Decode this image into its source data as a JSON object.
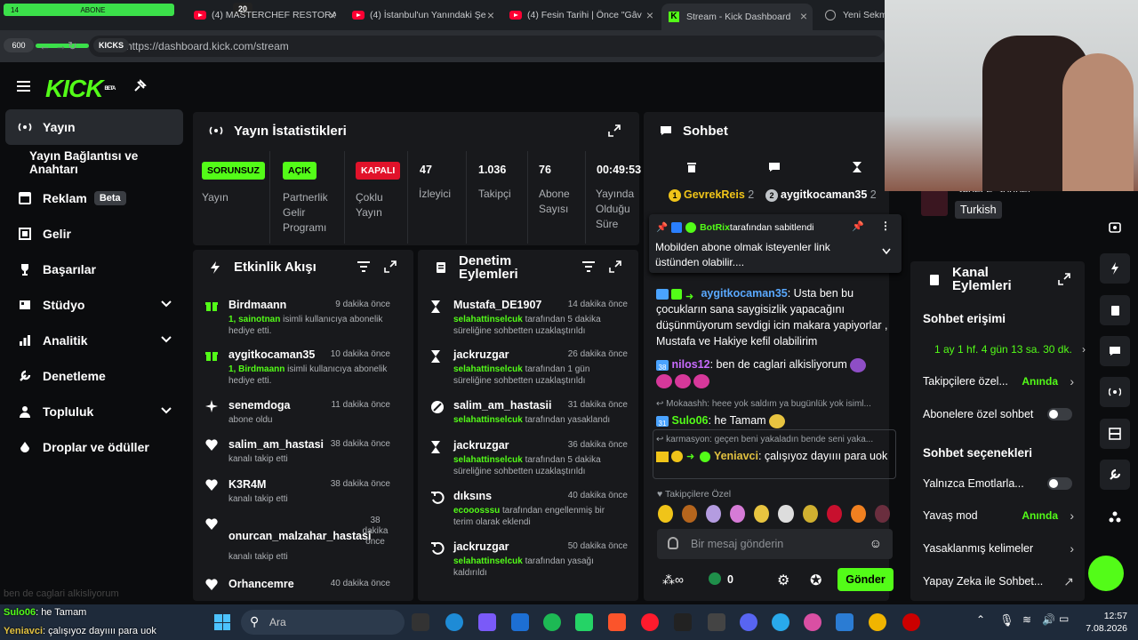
{
  "browser": {
    "green_bar_left": "14",
    "green_bar_mid": "ABONE",
    "badge_count": "20",
    "tabs": [
      {
        "title": "(4) MASTERCHEF RESTORA"
      },
      {
        "title": "(4) İstanbul'un Yanındaki Şe"
      },
      {
        "title": "(4) Fesin Tarihi | Önce \"Gâv"
      },
      {
        "title": "Stream - Kick Dashboard"
      },
      {
        "title": "Yeni Sekme"
      }
    ],
    "nav_pill": "600",
    "site_pill": "KICKS",
    "url": "https://dashboard.kick.com/stream"
  },
  "header": {
    "logo": "KICK",
    "logo_beta": "BETA"
  },
  "sidebar": {
    "items": [
      {
        "label": "Yayın"
      },
      {
        "label": "Yayın Bağlantısı ve Anahtarı"
      },
      {
        "label": "Reklam",
        "badge": "Beta"
      },
      {
        "label": "Gelir"
      },
      {
        "label": "Başarılar"
      },
      {
        "label": "Stüdyo"
      },
      {
        "label": "Analitik"
      },
      {
        "label": "Denetleme"
      },
      {
        "label": "Topluluk"
      },
      {
        "label": "Droplar ve ödüller"
      }
    ]
  },
  "stats": {
    "title": "Yayın İstatistikleri",
    "items": [
      {
        "pill": "SORUNSUZ",
        "label": "Yayın"
      },
      {
        "pill": "AÇIK",
        "label": "Partnerlik Gelir Programı"
      },
      {
        "pill": "KAPALI",
        "label": "Çoklu Yayın"
      },
      {
        "value": "47",
        "label": "İzleyici"
      },
      {
        "value": "1.036",
        "label": "Takipçi"
      },
      {
        "value": "76",
        "label": "Abone Sayısı"
      },
      {
        "value": "00:49:53",
        "label": "Yayında Olduğu Süre"
      }
    ]
  },
  "activity": {
    "title": "Etkinlik Akışı",
    "items": [
      {
        "name": "Birdmaann",
        "time": "9 dakika önce",
        "highlight": "1, sainotnan",
        "text": " isimli kullanıcıya abonelik hediye etti.",
        "icon": "gift-icon"
      },
      {
        "name": "aygitkocaman35",
        "time": "10 dakika önce",
        "highlight": "1, Birdmaann",
        "text": " isimli kullanıcıya abonelik hediye etti.",
        "icon": "gift-icon"
      },
      {
        "name": "senemdoga",
        "time": "11 dakika önce",
        "highlight": "",
        "text": "abone oldu",
        "icon": "sparkle-icon"
      },
      {
        "name": "salim_am_hastasi",
        "time": "38 dakika önce",
        "highlight": "",
        "text": "kanalı takip etti",
        "icon": "heart-icon"
      },
      {
        "name": "K3R4M",
        "time": "38 dakika önce",
        "highlight": "",
        "text": "kanalı takip etti",
        "icon": "heart-icon"
      },
      {
        "name": "onurcan_malzahar_hastasi",
        "time": "38 dakika önce",
        "highlight": "",
        "text": "kanalı takip etti",
        "icon": "heart-icon"
      },
      {
        "name": "Orhancemre",
        "time": "40 dakika önce",
        "highlight": "",
        "text": "",
        "icon": "heart-icon"
      }
    ]
  },
  "moderation": {
    "title": "Denetim Eylemleri",
    "items": [
      {
        "name": "Mustafa_DE1907",
        "time": "14 dakika önce",
        "highlight": "selahattinselcuk",
        "text": " tarafından 5 dakika süreliğine sohbetten uzaklaştırıldı"
      },
      {
        "name": "jackruzgar",
        "time": "26 dakika önce",
        "highlight": "selahattinselcuk",
        "text": " tarafından 1 gün süreliğine sohbetten uzaklaştırıldı"
      },
      {
        "name": "salim_am_hastasii",
        "time": "31 dakika önce",
        "highlight": "selahattinselcuk",
        "text": " tarafından yasaklandı"
      },
      {
        "name": "jackruzgar",
        "time": "36 dakika önce",
        "highlight": "selahattinselcuk",
        "text": " tarafından 5 dakika süreliğine sohbetten uzaklaştırıldı"
      },
      {
        "name": "dıksıns",
        "time": "40 dakika önce",
        "highlight": "ecooosssu",
        "text": " tarafından engellenmiş bir terim olarak eklendi"
      },
      {
        "name": "jackruzgar",
        "time": "50 dakika önce",
        "highlight": "selahattinselcuk",
        "text": " tarafından yasağı kaldırıldı"
      }
    ]
  },
  "chat": {
    "title": "Sohbet",
    "top_users": [
      {
        "name": "GevrekReis",
        "count": "2"
      },
      {
        "name": "aygitkocaman35",
        "count": "2"
      }
    ],
    "pinned_by": "BotRix",
    "pinned_suffix": " tarafından sabitlendi",
    "pinned_message": "Mobilden abone olmak isteyenler link üstünden olabilir....",
    "messages": [
      {
        "user": "aygitkocaman35",
        "color": "#5aa9ff",
        "text": ": Usta ben bu çocukların sana saygisizlik yapacağını düşünmüyorum sevdigi icin makara yapiyorlar , Mustafa ve Hakiye kefil olabilirim"
      },
      {
        "user": "nilos12",
        "color": "#c86bff",
        "text": ": ben de caglari alkisliyorum"
      },
      {
        "user": "Sulo06",
        "color": "#53fc18",
        "text": ": he Tamam",
        "reply": "Mokaashh: heee yok saldım ya bugünlük yok isiml..."
      },
      {
        "user": "Yeniavci",
        "color": "#e0c040",
        "text": ": çalışıyoz dayıııı para uok",
        "reply": "karmasyon: geçen beni yakaladın bende seni yaka..."
      }
    ],
    "followers_only": "Takipçilere Özel",
    "input_placeholder": "Bir mesaj gönderin",
    "points": "0",
    "send": "Gönder"
  },
  "right_panel": {
    "language_title": "Sadece Sohbet",
    "language": "Turkish",
    "title": "Kanal Eylemleri",
    "chat_access": "Sohbet erişimi",
    "account_age": "1 ay 1 hf. 4 gün 13 sa. 30 dk.",
    "followers_only": "Takipçilere özel...",
    "followers_value": "Anında",
    "subs_only": "Abonelere özel sohbet",
    "chat_options": "Sohbet seçenekleri",
    "emotes_only": "Yalnızca Emotlarla...",
    "slow_mode": "Yavaş mod",
    "slow_value": "Anında",
    "banned_words": "Yasaklanmış kelimeler",
    "ai": "Yapay Zeka ile Sohbet..."
  },
  "overlay": {
    "line1_user": "Sulo06",
    "line1_text": ": he Tamam",
    "line2_user": "Yeniavci",
    "line2_text": ": çalışıyoz dayıııı para uok",
    "ghost": "ben de caglari alkisliyorum"
  },
  "taskbar": {
    "search": "Ara",
    "time": "12:57",
    "date": "7.08.2026"
  }
}
